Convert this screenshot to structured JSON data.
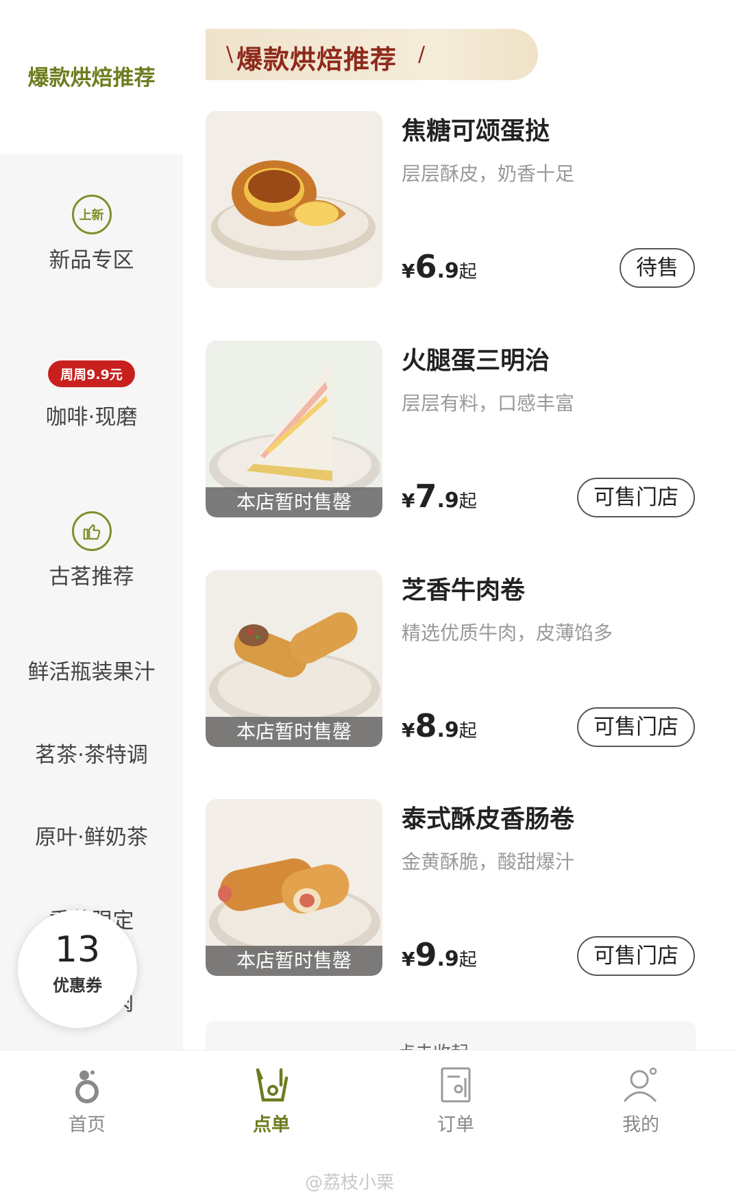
{
  "sidebar": {
    "active": "爆款烘焙推荐",
    "items": [
      {
        "label": "新品专区",
        "icon_text": "上新"
      },
      {
        "label": "咖啡·现磨",
        "badge": "周周9.9元"
      },
      {
        "label": "古茗推荐"
      },
      {
        "label": "鲜活瓶装果汁"
      },
      {
        "label": "茗茶·茶特调"
      },
      {
        "label": "原叶·鲜奶茶"
      },
      {
        "label": "季节限定"
      },
      {
        "label": "炭烤牛肉"
      }
    ]
  },
  "coupon": {
    "count": "13",
    "label": "优惠券"
  },
  "banner": {
    "title": "爆款烘焙推荐"
  },
  "products": [
    {
      "name": "焦糖可颂蛋挞",
      "desc": "层层酥皮，奶香十足",
      "yen": "¥",
      "price_int": "6",
      "price_dec": ".9",
      "suffix": "起",
      "button": "待售",
      "soldout": ""
    },
    {
      "name": "火腿蛋三明治",
      "desc": "层层有料，口感丰富",
      "yen": "¥",
      "price_int": "7",
      "price_dec": ".9",
      "suffix": "起",
      "button": "可售门店",
      "soldout": "本店暂时售罄"
    },
    {
      "name": "芝香牛肉卷",
      "desc": "精选优质牛肉，皮薄馅多",
      "yen": "¥",
      "price_int": "8",
      "price_dec": ".9",
      "suffix": "起",
      "button": "可售门店",
      "soldout": "本店暂时售罄"
    },
    {
      "name": "泰式酥皮香肠卷",
      "desc": "金黄酥脆，酸甜爆汁",
      "yen": "¥",
      "price_int": "9",
      "price_dec": ".9",
      "suffix": "起",
      "button": "可售门店",
      "soldout": "本店暂时售罄"
    }
  ],
  "collapse": {
    "label": "点击收起"
  },
  "tabbar": {
    "tabs": [
      {
        "label": "首页",
        "icon": "home-icon"
      },
      {
        "label": "点单",
        "icon": "order-icon",
        "active": true
      },
      {
        "label": "订单",
        "icon": "receipt-icon"
      },
      {
        "label": "我的",
        "icon": "profile-icon"
      }
    ]
  },
  "watermark": "@荔枝小栗",
  "colors": {
    "accent": "#6b7d1e",
    "banner_text": "#8e2a1c",
    "badge": "#c8201e"
  }
}
